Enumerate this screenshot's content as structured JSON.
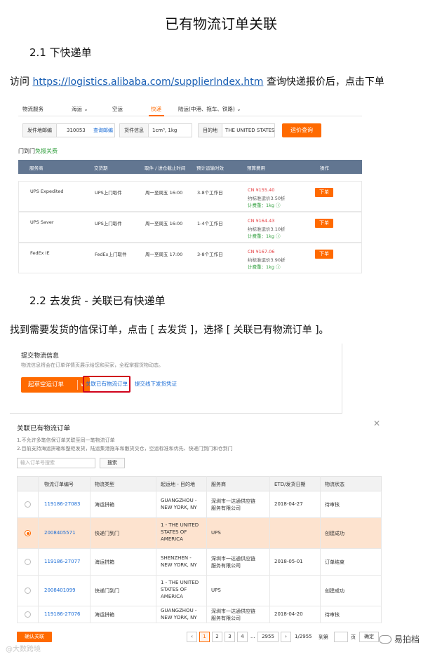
{
  "title": "已有物流订单关联",
  "section1": {
    "heading": "2.1  下快递单",
    "text_before": "访问 ",
    "link": "https://logistics.alibaba.com/supplierIndex.htm",
    "text_after": " 查询快递报价后，点击下单"
  },
  "shot1": {
    "tabs": [
      "物流服务",
      "海运 ⌄",
      "空运",
      "快递",
      "陆运(中港、拖车、铁路) ⌄"
    ],
    "from_label": "发件地邮编",
    "from_value": "310053",
    "from_link": "查询邮编",
    "cargo_label": "货件信息",
    "cargo_value": "1cm³, 1kg",
    "dest_label": "目的地",
    "dest_value": "THE UNITED STATES",
    "query_button": "运价查询",
    "door_label": "门到门",
    "door_free": "免报关费",
    "columns": [
      "服务商",
      "交货期",
      "取件 / 进仓截止时间",
      "预计运输时效",
      "预算费用",
      "操作"
    ],
    "rows": [
      {
        "carrier": "UPS Expedited",
        "pickup": "UPS上门取件",
        "window": "周一至周五 16:00",
        "transit": "3-8个工作日",
        "price": "CN ¥155.40",
        "discount": "约标准运价3.50折",
        "weight": "计费重：1kg ⓘ",
        "action": "下单"
      },
      {
        "carrier": "UPS Saver",
        "pickup": "UPS上门取件",
        "window": "周一至周五 16:00",
        "transit": "1-4个工作日",
        "price": "CN ¥164.43",
        "discount": "约标准运价3.10折",
        "weight": "计费重：1kg ⓘ",
        "action": "下单"
      },
      {
        "carrier": "FedEx IE",
        "pickup": "FedEx上门取件",
        "window": "周一至周五 17:00",
        "transit": "3-8个工作日",
        "price": "CN ¥167.06",
        "discount": "约标准运价3.90折",
        "weight": "计费重：1kg ⓘ",
        "action": "下单"
      }
    ]
  },
  "section2": {
    "heading": "2.2  去发货 - 关联已有快递单",
    "text": "找到需要发货的信保订单，点击 [ 去发货 ]，选择 [ 关联已有物流订单 ]。"
  },
  "shot2": {
    "title": "提交物流信息",
    "subtitle": "物流信息将会在订单详情页展示给您和买家，全程掌握货物动态。",
    "book_button": "起草空运订单",
    "book_chevron": "∨",
    "link_existing": "关联已有物流订单",
    "link_offline": "提交线下发货凭证"
  },
  "shot3": {
    "title": "关联已有物流订单",
    "close": "✕",
    "notes": [
      "1.不允许多笔信保订单关联至同一笔物流订单",
      "2.目前支持海运拼箱和整柜发货，陆运集港拖车和散货交仓，空运标准和优先、快递门到门和仓到门"
    ],
    "search_placeholder": "输入订单号搜索",
    "search_button": "搜索",
    "columns": [
      "物流订单编号",
      "物流类型",
      "起运地 - 目的地",
      "服务商",
      "ETD/发货日期",
      "物流状态"
    ],
    "rows": [
      {
        "selected": false,
        "id": "119186-27083",
        "type": "海运拼箱",
        "route": [
          "GUANGZHOU -",
          "NEW YORK, NY"
        ],
        "provider": [
          "深圳市一达通供应链",
          "服务有限公司"
        ],
        "date": "2018-04-27",
        "status": "待审核"
      },
      {
        "selected": true,
        "id": "2008405571",
        "type": "快递门到门",
        "route": [
          "1 - THE UNITED",
          "STATES OF",
          "AMERICA"
        ],
        "provider": [
          "UPS"
        ],
        "date": "",
        "status": "创建成功"
      },
      {
        "selected": false,
        "id": "119186-27077",
        "type": "海运拼箱",
        "route": [
          "SHENZHEN -",
          "NEW YORK, NY"
        ],
        "provider": [
          "深圳市一达通供应链",
          "服务有限公司"
        ],
        "date": "2018-05-01",
        "status": "订单结束"
      },
      {
        "selected": false,
        "id": "2008401099",
        "type": "快递门到门",
        "route": [
          "1 - THE UNITED",
          "STATES OF",
          "AMERICA"
        ],
        "provider": [
          "UPS"
        ],
        "date": "",
        "status": "创建成功"
      },
      {
        "selected": false,
        "id": "119186-27076",
        "type": "海运拼箱",
        "route": [
          "GUANGZHOU -",
          "NEW YORK, NY"
        ],
        "provider": [
          "深圳市一达通供应链",
          "服务有限公司"
        ],
        "date": "2018-04-20",
        "status": "待审核"
      }
    ],
    "confirm_button": "确认关联",
    "pager": {
      "prev": "‹",
      "pages": [
        "1",
        "2",
        "3",
        "4"
      ],
      "ellipsis": "...",
      "last": "2955",
      "next": "›",
      "summary": "1/2955",
      "goto": "到第",
      "unit": "页",
      "ok": "确定"
    }
  },
  "watermark_left": "@大数跨境",
  "watermark_right": "易拍档"
}
